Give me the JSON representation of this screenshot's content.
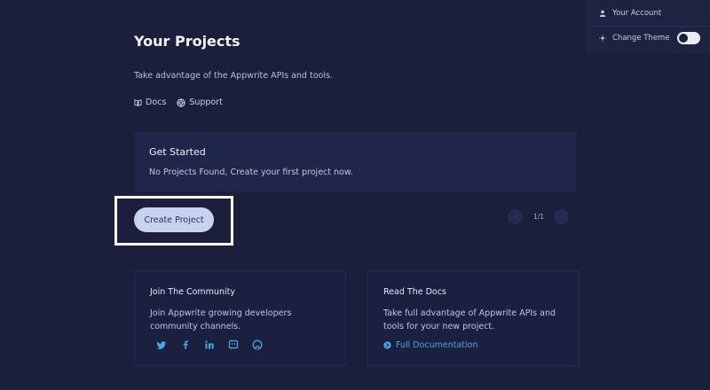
{
  "menu": {
    "account_label": "Your Account",
    "theme_label": "Change Theme",
    "theme_toggle_icon": "toggle-switch-icon"
  },
  "header": {
    "title": "Your Projects",
    "subtitle": "Take advantage of the Appwrite APIs and tools."
  },
  "links": {
    "docs_label": "Docs",
    "support_label": "Support"
  },
  "get_started": {
    "title": "Get Started",
    "text": "No Projects Found, Create your first project now."
  },
  "create_button_label": "Create Project",
  "pagination": {
    "text": "1/1",
    "prev_icon": "chevron-left-icon",
    "next_icon": "chevron-right-icon"
  },
  "community": {
    "title": "Join The Community",
    "text": "Join Appwrite growing developers community channels.",
    "socials": [
      "twitter-icon",
      "facebook-icon",
      "linkedin-icon",
      "discord-icon",
      "github-icon"
    ]
  },
  "read_docs": {
    "title": "Read The Docs",
    "text": "Take full advantage of Appwrite APIs and tools for your new project.",
    "link_label": "Full Documentation"
  },
  "colors": {
    "background": "#1b1f3b",
    "panel": "#20254a",
    "button": "#c6d2ee",
    "link": "#4aa8e0",
    "highlight": "#ffffff"
  }
}
